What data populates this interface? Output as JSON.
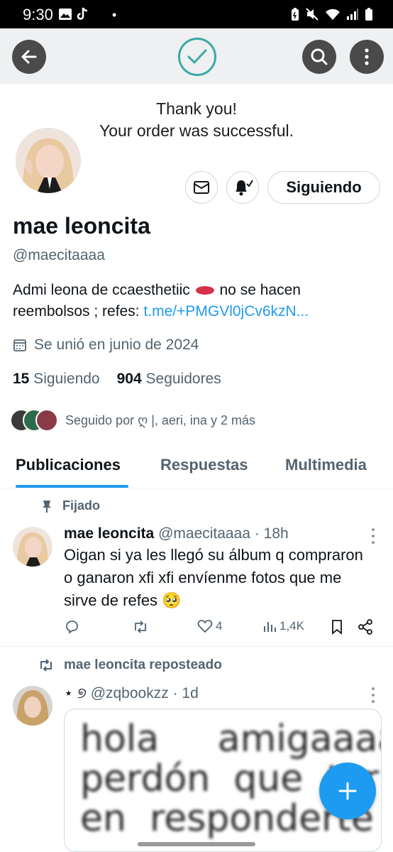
{
  "status_bar": {
    "time": "9:30",
    "left_icons": [
      "gallery-icon",
      "tiktok-icon"
    ],
    "right_icons": [
      "battery-saver-icon",
      "mute-icon",
      "wifi-icon",
      "signal-icon",
      "battery-icon"
    ]
  },
  "banner": {
    "thanks_line1": "Thank you!",
    "thanks_line2": "Your order was successful."
  },
  "profile": {
    "display_name": "mae leoncita",
    "handle": "@maecitaaaa",
    "follow_button": "Siguiendo",
    "bio_text": "Admi leona de ccaesthetiic",
    "bio_text2": "no se hacen",
    "bio_text3": "reembolsos ; refes:",
    "bio_link": "t.me/+PMGVl0jCv6kzN...",
    "joined": "Se unió en junio de 2024",
    "following_count": "15",
    "following_label": "Siguiendo",
    "followers_count": "904",
    "followers_label": "Seguidores",
    "followed_by": "Seguido por ღ |, aeri, ina y 2 más"
  },
  "tabs": [
    {
      "label": "Publicaciones",
      "active": true
    },
    {
      "label": "Respuestas",
      "active": false
    },
    {
      "label": "Multimedia",
      "active": false
    }
  ],
  "posts": [
    {
      "context": "Fijado",
      "author": "mae leoncita",
      "handle": "@maecitaaaa",
      "time": "· 18h",
      "text": "Oigan si ya les llegó su álbum q compraron o ganaron xfi xfi envíenme fotos que me sirve de refes 🥺",
      "likes": "4",
      "views": "1,4K"
    },
    {
      "context": "mae leoncita reposteado",
      "author_prefix": "⋆ ୭",
      "handle": "@zqbookzz",
      "time": "· 1d",
      "image_text": "hola     amigaaaaa\nperdón  que  tar\nen  responderte  es"
    }
  ],
  "colors": {
    "accent": "#1d9bf0",
    "text": "#0f1419",
    "muted": "#536471",
    "check_logo": "#3aa9a3"
  }
}
